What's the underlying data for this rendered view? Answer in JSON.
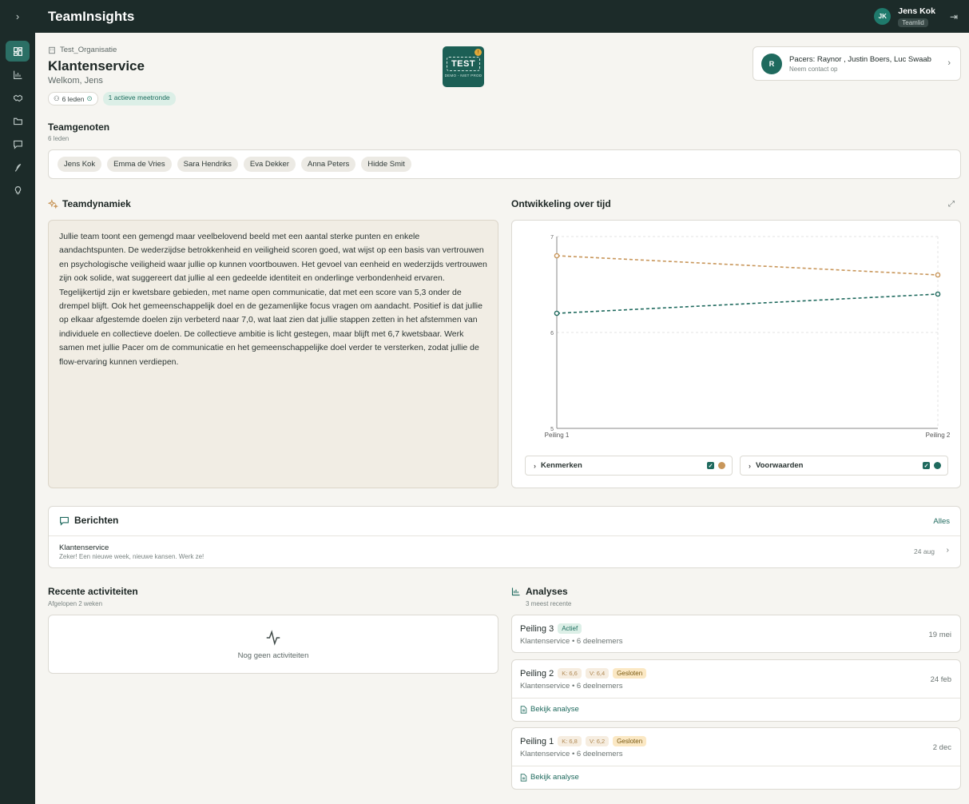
{
  "app": {
    "brand": "TeamInsights"
  },
  "user": {
    "initials": "JK",
    "name": "Jens Kok",
    "role": "Teamlid"
  },
  "header": {
    "org": "Test_Organisatie",
    "team": "Klantenservice",
    "welcome": "Welkom, Jens",
    "members_chip": "6 leden",
    "active_chip": "1 actieve meetronde",
    "logo_text": "TEST",
    "logo_sub": "DEMO - NIET PROD",
    "logo_badge": "!"
  },
  "pacers": {
    "initial": "R",
    "title": "Pacers: Raynor , Justin Boers, Luc Swaab",
    "subtitle": "Neem contact op"
  },
  "teammates": {
    "title": "Teamgenoten",
    "count": "6 leden",
    "names": [
      "Jens Kok",
      "Emma de Vries",
      "Sara Hendriks",
      "Eva Dekker",
      "Anna Peters",
      "Hidde Smit"
    ]
  },
  "dynamics": {
    "title": "Teamdynamiek",
    "text": "Jullie team toont een gemengd maar veelbelovend beeld met een aantal sterke punten en enkele aandachtspunten. De wederzijdse betrokkenheid en veiligheid scoren goed, wat wijst op een basis van vertrouwen en psychologische veiligheid waar jullie op kunnen voortbouwen. Het gevoel van eenheid en wederzijds vertrouwen zijn ook solide, wat suggereert dat jullie al een gedeelde identiteit en onderlinge verbondenheid ervaren. Tegelijkertijd zijn er kwetsbare gebieden, met name open communicatie, dat met een score van 5,3 onder de drempel blijft. Ook het gemeenschappelijk doel en de gezamenlijke focus vragen om aandacht. Positief is dat jullie op elkaar afgestemde doelen zijn verbeterd naar 7,0, wat laat zien dat jullie stappen zetten in het afstemmen van individuele en collectieve doelen. De collectieve ambitie is licht gestegen, maar blijft met 6,7 kwetsbaar. Werk samen met jullie Pacer om de communicatie en het gemeenschappelijke doel verder te versterken, zodat jullie de flow-ervaring kunnen verdiepen."
  },
  "chart": {
    "title": "Ontwikkeling over tijd",
    "legend": [
      "Kenmerken",
      "Voorwaarden"
    ],
    "colors": {
      "kenmerken": "#c8965a",
      "voorwaarden": "#1f6a5e"
    }
  },
  "chart_data": {
    "type": "line",
    "x": [
      "Peiling 1",
      "Peiling 2"
    ],
    "yticks": [
      "7",
      "6",
      "5"
    ],
    "ylim": [
      5,
      7
    ],
    "grid": true,
    "series": [
      {
        "name": "Kenmerken",
        "values": [
          6.8,
          6.6
        ]
      },
      {
        "name": "Voorwaarden",
        "values": [
          6.2,
          6.4
        ]
      }
    ]
  },
  "messages": {
    "title": "Berichten",
    "all_link": "Alles",
    "items": [
      {
        "title": "Klantenservice",
        "body": "Zeker! Een nieuwe week, nieuwe kansen. Werk ze!",
        "date": "24 aug"
      }
    ]
  },
  "activities": {
    "title": "Recente activiteiten",
    "subtitle": "Afgelopen 2 weken",
    "empty": "Nog geen activiteiten"
  },
  "analyses": {
    "title": "Analyses",
    "subtitle": "3 meest recente",
    "link_label": "Bekijk analyse",
    "items": [
      {
        "title": "Peiling 3",
        "status": "Actief",
        "meta": "Klantenservice • 6 deelnemers",
        "date": "19 mei"
      },
      {
        "title": "Peiling 2",
        "k": "K: 6,6",
        "v": "V: 6,4",
        "status": "Gesloten",
        "meta": "Klantenservice • 6 deelnemers",
        "date": "24 feb"
      },
      {
        "title": "Peiling 1",
        "k": "K: 6,8",
        "v": "V: 6,2",
        "status": "Gesloten",
        "meta": "Klantenservice • 6 deelnemers",
        "date": "2 dec"
      }
    ]
  }
}
